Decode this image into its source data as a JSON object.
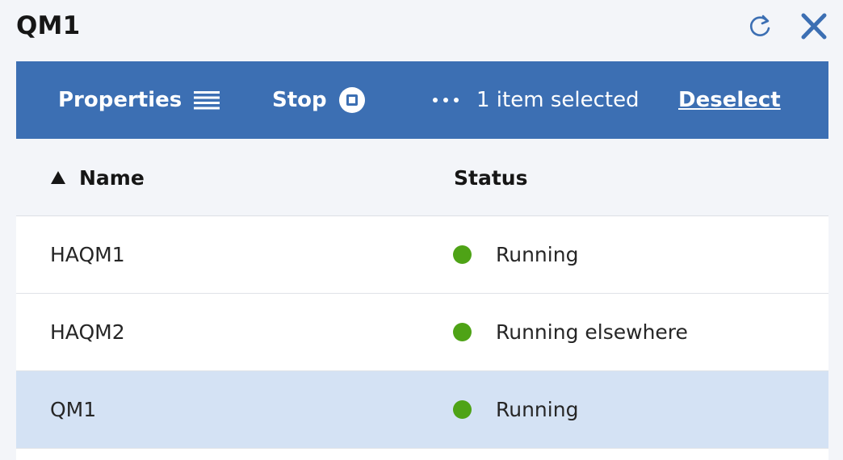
{
  "header": {
    "title": "QM1",
    "refresh_icon": "refresh-icon",
    "close_icon": "close-icon"
  },
  "toolbar": {
    "properties_label": "Properties",
    "properties_icon": "list-icon",
    "stop_label": "Stop",
    "stop_icon": "stop-icon",
    "more_icon": "overflow-menu-icon",
    "selection_text": "1 item selected",
    "deselect_label": "Deselect"
  },
  "table": {
    "columns": [
      {
        "label": "Name",
        "sort": "ascending"
      },
      {
        "label": "Status"
      }
    ],
    "rows": [
      {
        "name": "HAQM1",
        "status": "Running",
        "selected": false
      },
      {
        "name": "HAQM2",
        "status": "Running elsewhere",
        "selected": false
      },
      {
        "name": "QM1",
        "status": "Running",
        "selected": true
      }
    ]
  },
  "colors": {
    "toolbar_bg": "#3c6fb3",
    "status_running": "#4ea316",
    "selected_row": "#d4e2f4",
    "icon_blue": "#3c6fb3"
  }
}
